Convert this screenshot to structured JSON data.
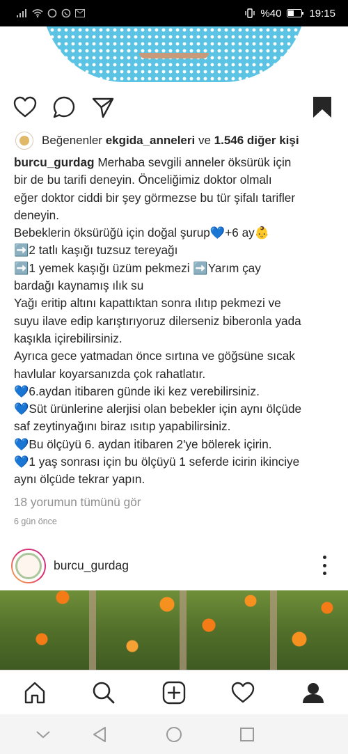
{
  "status_bar": {
    "battery_percent": "%40",
    "time": "19:15"
  },
  "post": {
    "likes": {
      "prefix": "Beğenenler",
      "liked_by": "ekgida_anneleri",
      "conjunction": "ve",
      "others": "1.546 diğer kişi"
    },
    "caption": {
      "username": "burcu_gurdag",
      "lines": [
        " Merhaba sevgili anneler öksürük için",
        "bir de bu tarifi deneyin. Önceliğimiz doktor olmalı",
        "eğer doktor ciddi bir şey görmezse bu tür şifalı tarifler",
        "deneyin.",
        "Bebeklerin öksürüğü için doğal şurup💙+6 ay👶",
        "➡️2 tatlı kaşığı tuzsuz tereyağı",
        "➡️1 yemek kaşığı üzüm pekmezi ➡️Yarım çay",
        "bardağı kaynamış ılık su",
        "Yağı eritip altını kapattıktan sonra ılıtıp pekmezi ve",
        "suyu ilave edip karıştırıyoruz dilerseniz biberonla yada",
        "kaşıkla içirebilirsiniz.",
        "Ayrıca gece yatmadan önce sırtına ve göğsüne sıcak",
        "havlular koyarsanızda çok rahatlatır.",
        "💙6.aydan itibaren günde iki kez verebilirsiniz.",
        "💙Süt ürünlerine alerjisi olan bebekler için aynı ölçüde",
        "saf zeytinyağını biraz ısıtıp yapabilirsiniz.",
        "💙Bu ölçüyü 6. aydan itibaren 2'ye bölerek içirin.",
        "💙1 yaş sonrası için bu ölçüyü 1 seferde icirin ikinciye",
        "aynı ölçüde tekrar yapın."
      ]
    },
    "view_comments": "18 yorumun tümünü gör",
    "time_ago": "6 gün önce"
  },
  "next_post": {
    "username": "burcu_gurdag"
  },
  "icons": {
    "like": "heart-icon",
    "comment": "comment-icon",
    "share": "share-icon",
    "save": "bookmark-icon",
    "nav": [
      "home-icon",
      "search-icon",
      "add-post-icon",
      "activity-heart-icon",
      "profile-icon"
    ]
  }
}
